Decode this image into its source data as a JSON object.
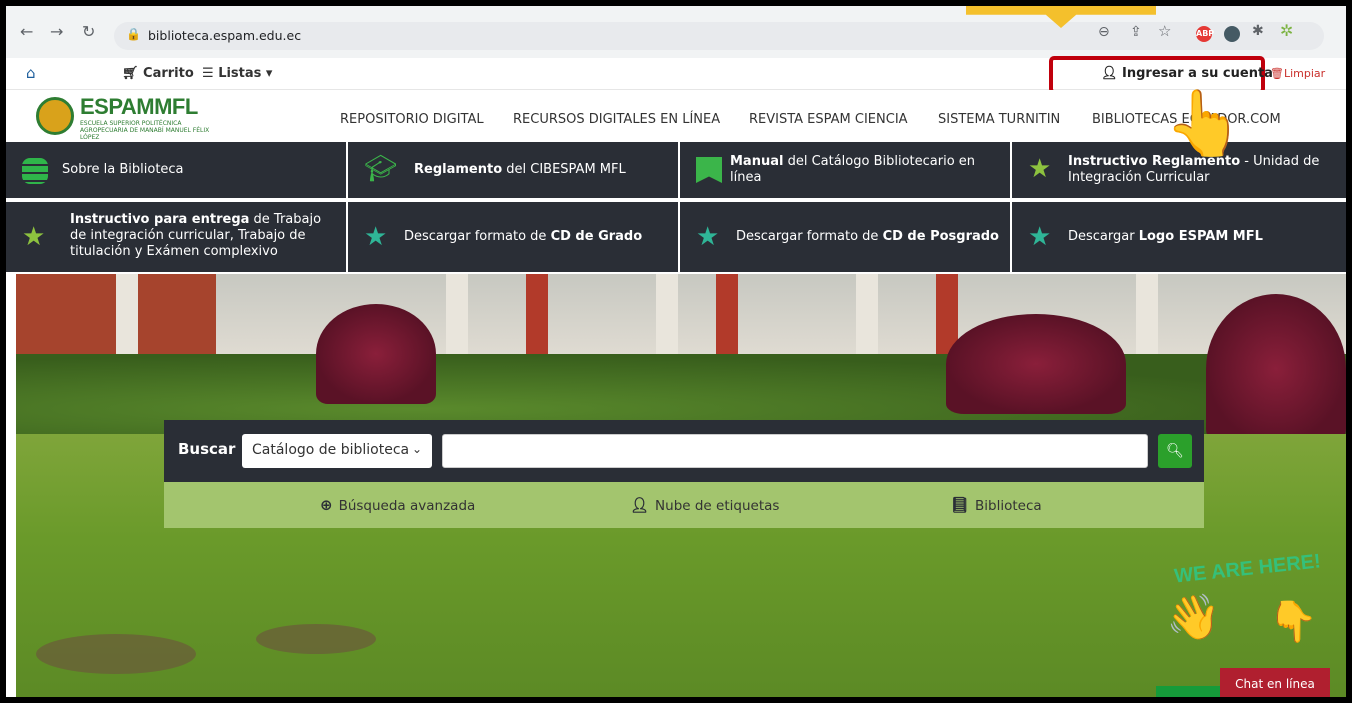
{
  "browser": {
    "url": "biblioteca.espam.edu.ec",
    "extension_label": "ABP"
  },
  "utilbar": {
    "cart_label": "Carrito",
    "lists_label": "Listas",
    "login_label": "Ingresar a su cuenta",
    "clear_label": "Limpiar"
  },
  "header": {
    "logo_title": "ESPAMMFL",
    "logo_subtitle": "ESCUELA SUPERIOR POLITÉCNICA AGROPECUARIA DE MANABÍ MANUEL FÉLIX LÓPEZ",
    "nav": [
      "REPOSITORIO DIGITAL",
      "RECURSOS DIGITALES EN LÍNEA",
      "REVISTA ESPAM CIENCIA",
      "SISTEMA TURNITIN",
      "BIBLIOTECAS ECUADOR.COM"
    ]
  },
  "tiles": [
    {
      "icon": "database-icon",
      "bold": "",
      "text": "Sobre la Biblioteca"
    },
    {
      "icon": "graduation-cap-icon",
      "bold": "Reglamento",
      "text": " del CIBESPAM MFL"
    },
    {
      "icon": "bookmark-icon",
      "bold": "Manual",
      "text": " del Catálogo Bibliotecario en línea"
    },
    {
      "icon": "star-icon",
      "bold": "Instructivo Reglamento",
      "text": " - Unidad de Integración Curricular"
    },
    {
      "icon": "star-icon",
      "bold": "Instructivo para entrega",
      "text": " de Trabajo de integración curricular, Trabajo de titulación y Exámen complexivo"
    },
    {
      "icon": "star-icon",
      "bold": "CD de Grado",
      "text": "Descargar formato de "
    },
    {
      "icon": "star-icon",
      "bold": "CD de Posgrado",
      "text": "Descargar formato de "
    },
    {
      "icon": "star-icon",
      "bold": "Logo ESPAM MFL",
      "text": "Descargar "
    }
  ],
  "search": {
    "label": "Buscar",
    "scope": "Catálogo de biblioteca",
    "query": "",
    "links": [
      "Búsqueda avanzada",
      "Nube de etiquetas",
      "Biblioteca"
    ]
  },
  "chat": {
    "banner": "WE ARE HERE!",
    "button": "Chat en línea"
  },
  "colors": {
    "tile_bg": "#2a2e36",
    "search_links_bg": "#a3c56e",
    "search_button": "#2ba02b",
    "highlight_border": "#c0000c",
    "chat_button": "#b01f2f"
  }
}
